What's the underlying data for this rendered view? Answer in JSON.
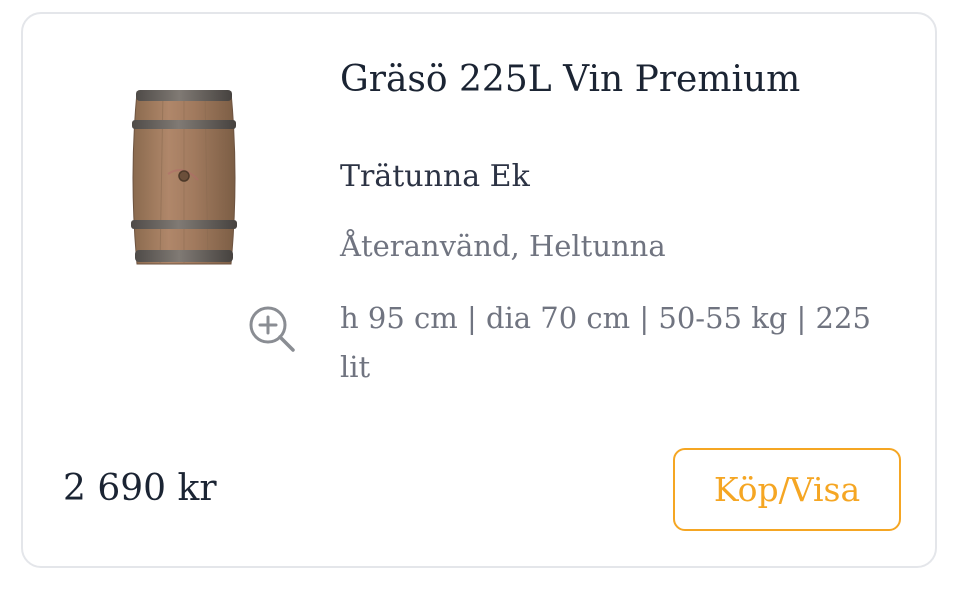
{
  "product": {
    "title": "Gräsö 225L Vin Premium",
    "type": "Trätunna Ek",
    "condition": "Återanvänd, Heltunna",
    "specs": "h 95 cm | dia 70 cm | 50-55 kg | 225 lit",
    "price": "2 690 kr",
    "image_icon": "oak-wine-barrel-image",
    "zoom_icon": "zoom-in-icon"
  },
  "actions": {
    "buy_label": "Köp/Visa"
  },
  "colors": {
    "accent": "#f5a623",
    "title_text": "#1b2433",
    "muted_text": "#707480",
    "card_border": "#e4e6ea"
  }
}
